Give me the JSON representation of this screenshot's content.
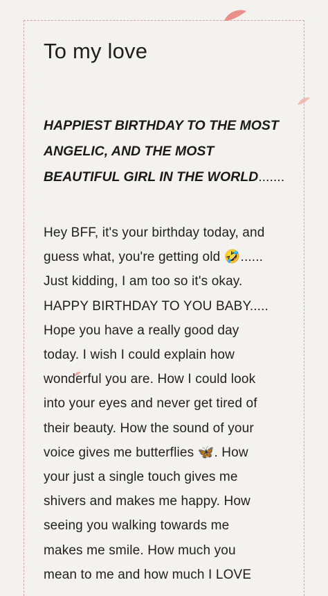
{
  "letter": {
    "title": "To my love",
    "headline": "HAPPIEST BIRTHDAY TO THE MOST ANGELIC, AND THE MOST BEAUTIFUL GIRL IN THE WORLD",
    "headline_trail": ".......",
    "body_lines": [
      "Hey BFF, it's your birthday today, and",
      "guess what, you're getting old 🤣......",
      "Just kidding, I am too so it's okay.",
      "HAPPY BIRTHDAY TO YOU BABY.....",
      "Hope you have a really good day",
      "today. I wish I could explain how",
      "wonderful you are. How I could look",
      "into your eyes and never get tired of",
      "their beauty. How the sound of your",
      "voice gives me butterflies 🦋. How",
      "your just a single touch gives me",
      "shivers and makes me happy. How",
      "seeing you walking towards me",
      "makes me smile. How much you",
      "mean to me and how much I LOVE"
    ]
  },
  "colors": {
    "background": "#f4f2ef",
    "border": "#d9a3a3",
    "petal": "#e8857f"
  }
}
